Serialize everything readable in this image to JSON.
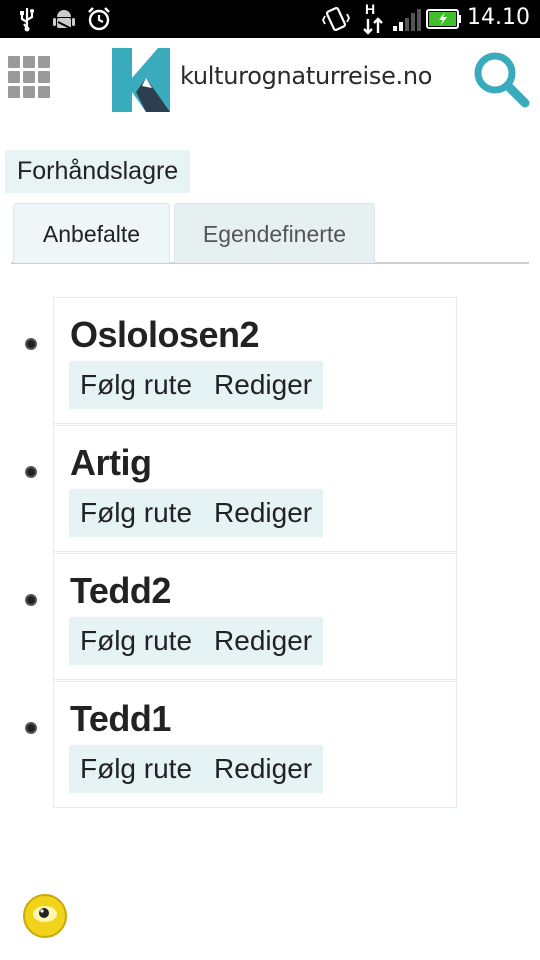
{
  "status_bar": {
    "time": "14.10",
    "network": "H",
    "icons": [
      "usb-icon",
      "android-debug-icon",
      "alarm-icon",
      "vibrate-icon",
      "network-h-icon",
      "signal-icon",
      "battery-charging-icon"
    ]
  },
  "header": {
    "menu_icon": "grid-menu-icon",
    "logo_text": "kulturognaturreise.no",
    "search_icon": "search-icon",
    "colors": {
      "accent": "#3aaabd",
      "logo_dark": "#2c3e50"
    }
  },
  "preset": {
    "label": "Forhåndslagre"
  },
  "tabs": [
    {
      "label": "Anbefalte",
      "active": true
    },
    {
      "label": "Egendefinerte",
      "active": false
    }
  ],
  "routes": [
    {
      "name": "Oslolosen2",
      "follow_label": "Følg rute",
      "edit_label": "Rediger"
    },
    {
      "name": "Artig",
      "follow_label": "Følg rute",
      "edit_label": "Rediger"
    },
    {
      "name": "Tedd2",
      "follow_label": "Følg rute",
      "edit_label": "Rediger"
    },
    {
      "name": "Tedd1",
      "follow_label": "Følg rute",
      "edit_label": "Rediger"
    }
  ],
  "footer": {
    "brand_icon": "wikitude-logo-icon"
  }
}
